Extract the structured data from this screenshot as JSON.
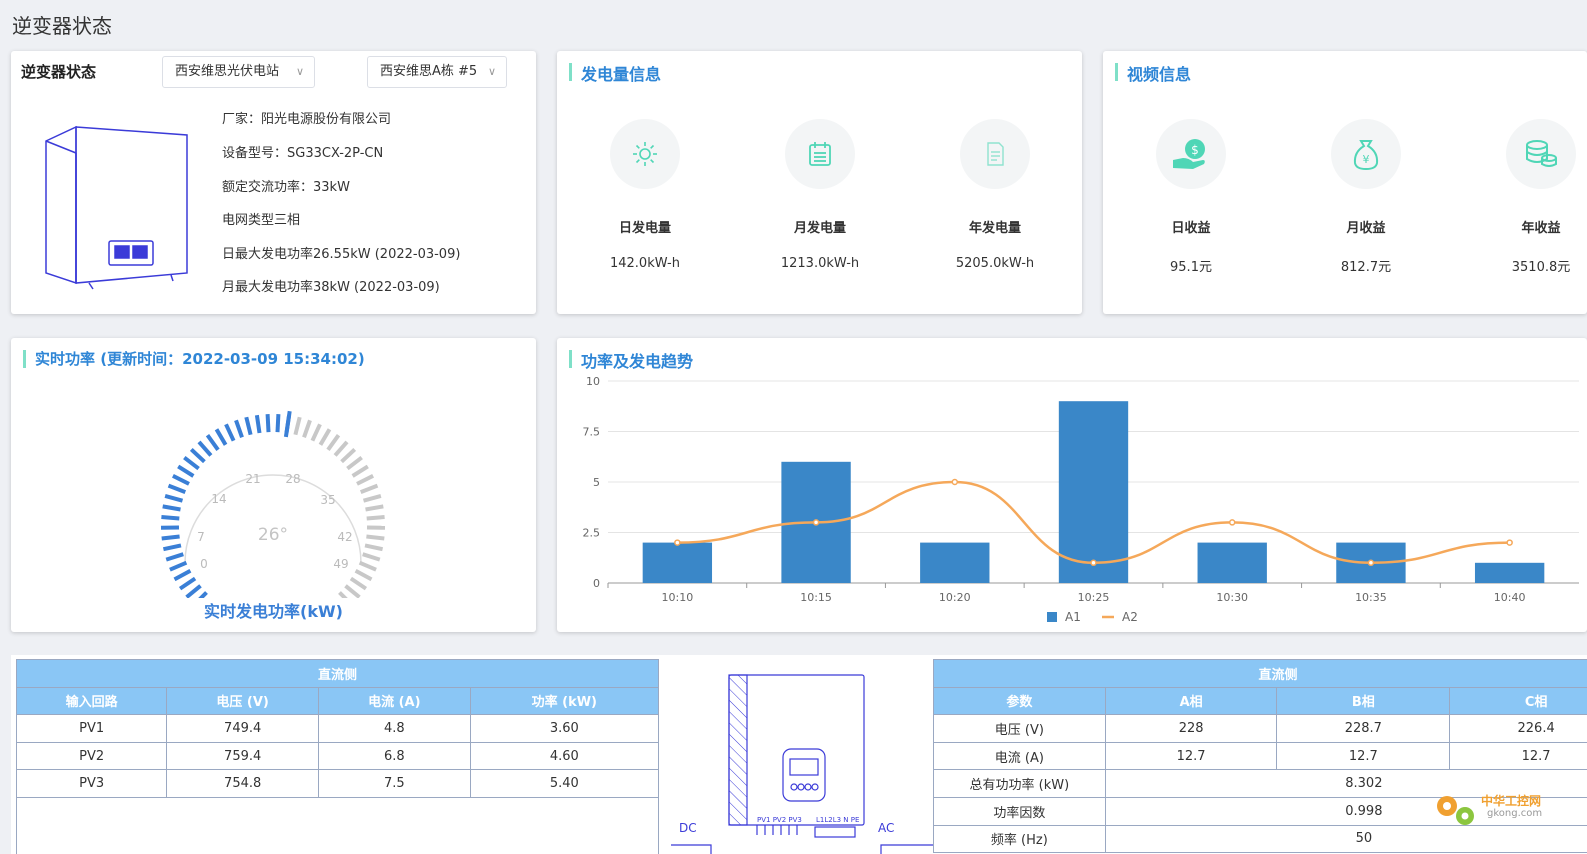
{
  "page_title": "逆变器状态",
  "status_card": {
    "title": "逆变器状态",
    "station_select": "西安维思光伏电站",
    "building_select": "西安维思A栋 #5",
    "info": [
      "厂家：阳光电源股份有限公司",
      "设备型号：SG33CX-2P-CN",
      "额定交流功率：33kW",
      "电网类型三相",
      "日最大发电功率26.55kW (2022-03-09)",
      "月最大发电功率38kW (2022-03-09)"
    ]
  },
  "energy_card": {
    "title": "发电量信息",
    "stats": [
      {
        "label": "日发电量",
        "value": "142.0kW-h",
        "icon": "sun-icon"
      },
      {
        "label": "月发电量",
        "value": "1213.0kW-h",
        "icon": "calendar-icon"
      },
      {
        "label": "年发电量",
        "value": "5205.0kW-h",
        "icon": "document-icon"
      }
    ]
  },
  "revenue_card": {
    "title": "视频信息",
    "stats": [
      {
        "label": "日收益",
        "value": "95.1元",
        "icon": "hand-coin-icon"
      },
      {
        "label": "月收益",
        "value": "812.7元",
        "icon": "money-bag-icon"
      },
      {
        "label": "年收益",
        "value": "3510.8元",
        "icon": "coin-stack-icon"
      }
    ]
  },
  "gauge_card": {
    "title": "实时功率 (更新时间：2022-03-09 15:34:02)",
    "gauge_labels": [
      "0",
      "7",
      "14",
      "21",
      "28",
      "35",
      "42",
      "49"
    ],
    "gauge_value_text": "26°",
    "gauge_value": 26,
    "gauge_max": 49,
    "gauge_caption": "实时发电功率(kW)",
    "colors": {
      "active": "#3a7fd6",
      "inactive": "#c8c8c8"
    }
  },
  "trend_card": {
    "title": "功率及发电趋势"
  },
  "chart_data": {
    "type": "bar",
    "categories": [
      "10:10",
      "10:15",
      "10:20",
      "10:25",
      "10:30",
      "10:35",
      "10:40"
    ],
    "series": [
      {
        "name": "A1",
        "type": "bar",
        "values": [
          2,
          6,
          2,
          9,
          2,
          2,
          1
        ],
        "color": "#3a87c8"
      },
      {
        "name": "A2",
        "type": "line",
        "values": [
          2,
          3,
          5,
          1,
          3,
          1,
          2
        ],
        "color": "#f5a85a"
      }
    ],
    "yticks": [
      "0",
      "2.5",
      "5",
      "7.5",
      "10"
    ],
    "ylim": [
      0,
      10
    ],
    "grid": true,
    "legend": "bottom-center"
  },
  "dc_table": {
    "title": "直流侧",
    "headers": [
      "输入回路",
      "电压 (V)",
      "电流 (A)",
      "功率 (kW)"
    ],
    "rows": [
      [
        "PV1",
        "749.4",
        "4.8",
        "3.60"
      ],
      [
        "PV2",
        "759.4",
        "6.8",
        "4.60"
      ],
      [
        "PV3",
        "754.8",
        "7.5",
        "5.40"
      ]
    ]
  },
  "diagram": {
    "dc_label": "DC",
    "ac_label": "AC",
    "pv_label": "PV1 PV2 PV3",
    "ac_ports_label": "L1L2L3 N PE"
  },
  "ac_table": {
    "title": "直流侧",
    "headers": [
      "参数",
      "A相",
      "B相",
      "C相"
    ],
    "rows3": [
      [
        "电压 (V)",
        "228",
        "228.7",
        "226.4"
      ],
      [
        "电流 (A)",
        "12.7",
        "12.7",
        "12.7"
      ]
    ],
    "rows1": [
      [
        "总有功功率 (kW)",
        "8.302"
      ],
      [
        "功率因数",
        "0.998"
      ],
      [
        "频率 (Hz)",
        "50"
      ]
    ]
  },
  "watermark": {
    "line1": "中华工控网",
    "line2": "gkong.com"
  }
}
